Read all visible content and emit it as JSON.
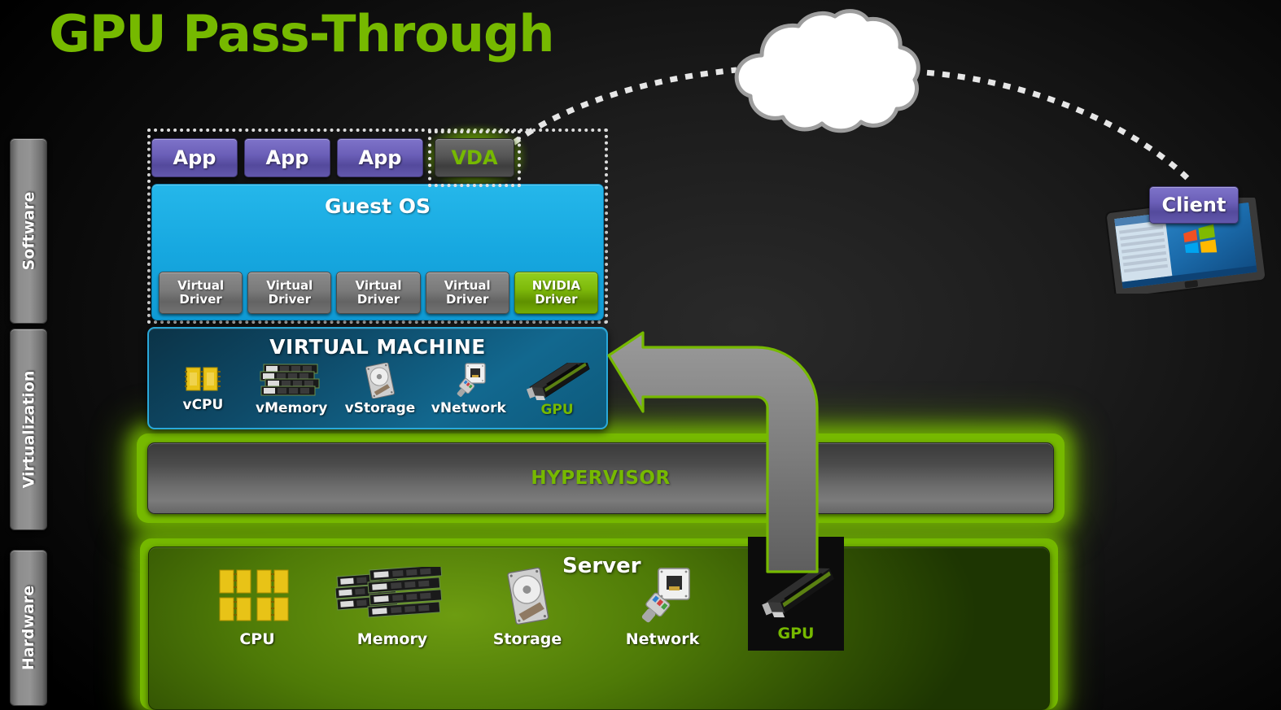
{
  "title": "GPU Pass-Through",
  "accent_green": "#76b900",
  "rails": [
    {
      "id": "software",
      "label": "Software"
    },
    {
      "id": "virtualization",
      "label": "Virtualization"
    },
    {
      "id": "hardware",
      "label": "Hardware"
    }
  ],
  "apps": [
    {
      "label": "App"
    },
    {
      "label": "App"
    },
    {
      "label": "App"
    }
  ],
  "vda": {
    "label": "VDA"
  },
  "guest_os": {
    "label": "Guest OS",
    "drivers": [
      {
        "line1": "Virtual",
        "line2": "Driver",
        "highlight": false
      },
      {
        "line1": "Virtual",
        "line2": "Driver",
        "highlight": false
      },
      {
        "line1": "Virtual",
        "line2": "Driver",
        "highlight": false
      },
      {
        "line1": "Virtual",
        "line2": "Driver",
        "highlight": false
      },
      {
        "line1": "NVIDIA",
        "line2": "Driver",
        "highlight": true
      }
    ]
  },
  "virtual_machine": {
    "title": "VIRTUAL MACHINE",
    "items": [
      {
        "label": "vCPU",
        "icon": "cpu-icon"
      },
      {
        "label": "vMemory",
        "icon": "memory-icon"
      },
      {
        "label": "vStorage",
        "icon": "harddisk-icon"
      },
      {
        "label": "vNetwork",
        "icon": "network-jack-icon"
      },
      {
        "label": "GPU",
        "icon": "graphics-card-icon"
      }
    ]
  },
  "hypervisor": {
    "label": "HYPERVISOR"
  },
  "server": {
    "title": "Server",
    "items": [
      {
        "label": "CPU",
        "icon": "cpu-icon"
      },
      {
        "label": "Memory",
        "icon": "memory-icon"
      },
      {
        "label": "Storage",
        "icon": "harddisk-icon"
      },
      {
        "label": "Network",
        "icon": "network-jack-icon"
      }
    ],
    "gpu": {
      "label": "GPU",
      "icon": "graphics-card-icon"
    }
  },
  "client": {
    "label": "Client",
    "device": "windows-tablet-icon"
  },
  "cloud": {
    "icon": "cloud-icon"
  },
  "arrow": {
    "icon": "passthrough-arrow-icon"
  }
}
